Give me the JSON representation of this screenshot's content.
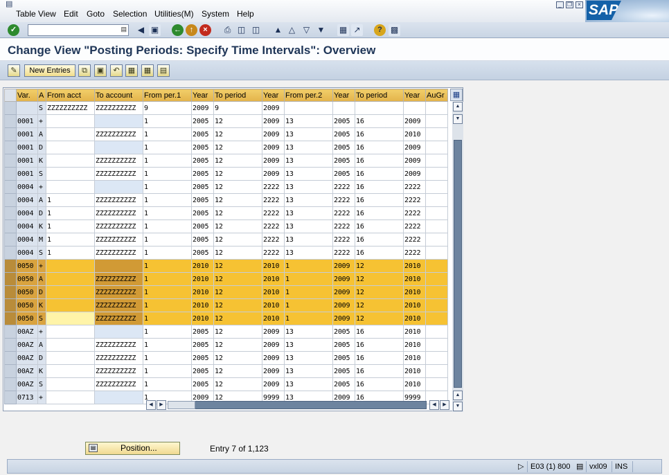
{
  "menubar": {
    "items": [
      "Table View",
      "Edit",
      "Goto",
      "Selection",
      "Utilities(M)",
      "System",
      "Help"
    ],
    "logo": "SAP"
  },
  "title": "Change View \"Posting Periods: Specify Time Intervals\": Overview",
  "app_toolbar": {
    "new_entries_label": "New Entries"
  },
  "table": {
    "columns": [
      "Var.",
      "A",
      "From acct",
      "To account",
      "From per.1",
      "Year",
      "To period",
      "Year",
      "From per.2",
      "Year",
      "To period",
      "Year",
      "AuGr"
    ],
    "rows": [
      [
        "",
        "S",
        "ZZZZZZZZZZ",
        "ZZZZZZZZZZ",
        "9",
        "2009",
        "9",
        "2009",
        "",
        "",
        "",
        "",
        ""
      ],
      [
        "0001",
        "+",
        "",
        "",
        "1",
        "2005",
        "12",
        "2009",
        "13",
        "2005",
        "16",
        "2009",
        ""
      ],
      [
        "0001",
        "A",
        "",
        "ZZZZZZZZZZ",
        "1",
        "2005",
        "12",
        "2009",
        "13",
        "2005",
        "16",
        "2010",
        ""
      ],
      [
        "0001",
        "D",
        "",
        "",
        "1",
        "2005",
        "12",
        "2009",
        "13",
        "2005",
        "16",
        "2009",
        ""
      ],
      [
        "0001",
        "K",
        "",
        "ZZZZZZZZZZ",
        "1",
        "2005",
        "12",
        "2009",
        "13",
        "2005",
        "16",
        "2009",
        ""
      ],
      [
        "0001",
        "S",
        "",
        "ZZZZZZZZZZ",
        "1",
        "2005",
        "12",
        "2009",
        "13",
        "2005",
        "16",
        "2009",
        ""
      ],
      [
        "0004",
        "+",
        "",
        "",
        "1",
        "2005",
        "12",
        "2222",
        "13",
        "2222",
        "16",
        "2222",
        ""
      ],
      [
        "0004",
        "A",
        "1",
        "ZZZZZZZZZZ",
        "1",
        "2005",
        "12",
        "2222",
        "13",
        "2222",
        "16",
        "2222",
        ""
      ],
      [
        "0004",
        "D",
        "1",
        "ZZZZZZZZZZ",
        "1",
        "2005",
        "12",
        "2222",
        "13",
        "2222",
        "16",
        "2222",
        ""
      ],
      [
        "0004",
        "K",
        "1",
        "ZZZZZZZZZZ",
        "1",
        "2005",
        "12",
        "2222",
        "13",
        "2222",
        "16",
        "2222",
        ""
      ],
      [
        "0004",
        "M",
        "1",
        "ZZZZZZZZZZ",
        "1",
        "2005",
        "12",
        "2222",
        "13",
        "2222",
        "16",
        "2222",
        ""
      ],
      [
        "0004",
        "S",
        "1",
        "ZZZZZZZZZZ",
        "1",
        "2005",
        "12",
        "2222",
        "13",
        "2222",
        "16",
        "2222",
        ""
      ],
      [
        "0050",
        "+",
        "",
        "",
        "1",
        "2010",
        "12",
        "2010",
        "1",
        "2009",
        "12",
        "2010",
        ""
      ],
      [
        "0050",
        "A",
        "",
        "ZZZZZZZZZZ",
        "1",
        "2010",
        "12",
        "2010",
        "1",
        "2009",
        "12",
        "2010",
        ""
      ],
      [
        "0050",
        "D",
        "",
        "ZZZZZZZZZZ",
        "1",
        "2010",
        "12",
        "2010",
        "1",
        "2009",
        "12",
        "2010",
        ""
      ],
      [
        "0050",
        "K",
        "",
        "ZZZZZZZZZZ",
        "1",
        "2010",
        "12",
        "2010",
        "1",
        "2009",
        "12",
        "2010",
        ""
      ],
      [
        "0050",
        "S",
        "",
        "ZZZZZZZZZZ",
        "1",
        "2010",
        "12",
        "2010",
        "1",
        "2009",
        "12",
        "2010",
        ""
      ],
      [
        "00AZ",
        "+",
        "",
        "",
        "1",
        "2005",
        "12",
        "2009",
        "13",
        "2005",
        "16",
        "2010",
        ""
      ],
      [
        "00AZ",
        "A",
        "",
        "ZZZZZZZZZZ",
        "1",
        "2005",
        "12",
        "2009",
        "13",
        "2005",
        "16",
        "2010",
        ""
      ],
      [
        "00AZ",
        "D",
        "",
        "ZZZZZZZZZZ",
        "1",
        "2005",
        "12",
        "2009",
        "13",
        "2005",
        "16",
        "2010",
        ""
      ],
      [
        "00AZ",
        "K",
        "",
        "ZZZZZZZZZZ",
        "1",
        "2005",
        "12",
        "2009",
        "13",
        "2005",
        "16",
        "2010",
        ""
      ],
      [
        "00AZ",
        "S",
        "",
        "ZZZZZZZZZZ",
        "1",
        "2005",
        "12",
        "2009",
        "13",
        "2005",
        "16",
        "2010",
        ""
      ],
      [
        "0713",
        "+",
        "",
        "",
        "1",
        "2009",
        "12",
        "9999",
        "13",
        "2009",
        "16",
        "9999",
        ""
      ]
    ],
    "highlighted_rows": [
      12,
      13,
      14,
      15,
      16
    ]
  },
  "position_button": {
    "label": "Position..."
  },
  "entry_info": "Entry 7 of 1,123",
  "statusbar": {
    "system": "E03 (1) 800",
    "server": "vxl09",
    "mode": "INS"
  }
}
